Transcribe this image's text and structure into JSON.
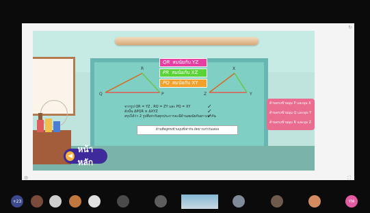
{
  "slide": {
    "banners": [
      {
        "math": "QR",
        "text": "สมนัยกับ YZ"
      },
      {
        "math": "PR",
        "text": "สมนัยกับ XZ"
      },
      {
        "math": "PQ",
        "text": "สมนัยกับ XY"
      }
    ],
    "triangle_left_labels": {
      "top": "R",
      "left": "Q",
      "right": "P"
    },
    "triangle_right_labels": {
      "top": "X",
      "left": "Z",
      "right": "Y"
    },
    "proof_lines": [
      "จากรูป QR = YZ , RQ = ZY และ PQ = XY",
      "ดังนั้น ΔPQR ≅ ΔXYZ",
      "สรุปได้ว่า 2 รูปที่เท่ากันทุกประการจะมีด้านสมนัยกันยาวเท่ากัน"
    ],
    "proof_box": "ด้านที่อยู่ตรงข้ามมุมที่เท่ากัน ยัดยาวเท่ากันเสมอ",
    "correspondence": [
      "ด้านตรงข้ามมุม P และมุม X",
      "ด้านตรงข้ามมุม Q และมุม Y",
      "ด้านตรงข้ามมุม R และมุม Z"
    ],
    "home_tag": "หน้าหลัก"
  },
  "participants": [
    "+23",
    "",
    "",
    "",
    "",
    "",
    "",
    "",
    "",
    "",
    "YM"
  ],
  "colors": {
    "accent_pink": "#e63ea3",
    "accent_green": "#5bd437",
    "accent_orange": "#f2a12b",
    "home_purple": "#3f2a9b"
  }
}
